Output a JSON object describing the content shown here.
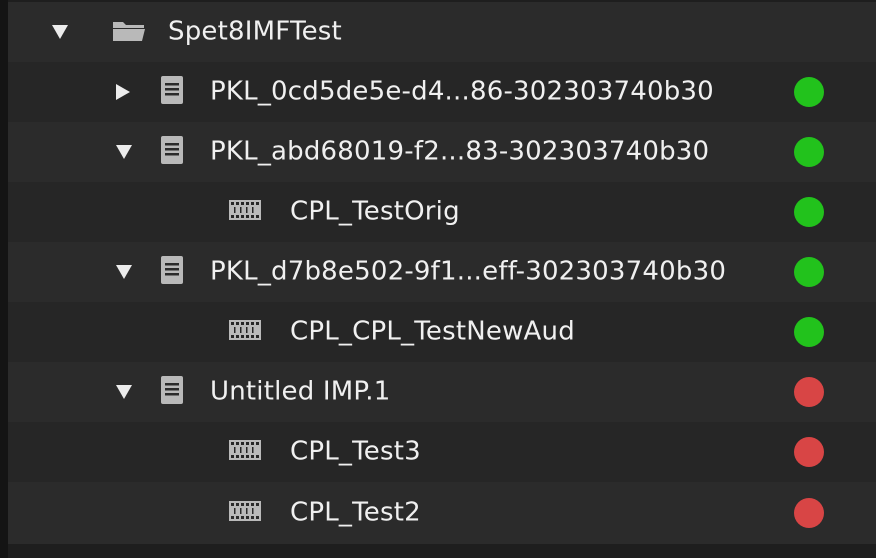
{
  "colors": {
    "ok": "#22c21c",
    "error": "#d84545",
    "text": "#f0f0f0",
    "icon": "#b9b9b9"
  },
  "tree": {
    "root": {
      "label": "Spet8IMFTest",
      "expanded": true,
      "icon": "folder-icon"
    },
    "items": [
      {
        "label": "PKL_0cd5de5e-d4...86-302303740b30",
        "type": "pkl",
        "expanded": false,
        "icon": "document-icon",
        "status": "ok"
      },
      {
        "label": "PKL_abd68019-f2...83-302303740b30",
        "type": "pkl",
        "expanded": true,
        "icon": "document-icon",
        "status": "ok"
      },
      {
        "label": "CPL_TestOrig",
        "type": "cpl",
        "icon": "film-icon",
        "status": "ok"
      },
      {
        "label": "PKL_d7b8e502-9f1...eff-302303740b30",
        "type": "pkl",
        "expanded": true,
        "icon": "document-icon",
        "status": "ok"
      },
      {
        "label": "CPL_CPL_TestNewAud",
        "type": "cpl",
        "icon": "film-icon",
        "status": "ok"
      },
      {
        "label": "Untitled IMP.1",
        "type": "pkl",
        "expanded": true,
        "icon": "document-icon",
        "status": "error"
      },
      {
        "label": "CPL_Test3",
        "type": "cpl",
        "icon": "film-icon",
        "status": "error"
      },
      {
        "label": "CPL_Test2",
        "type": "cpl",
        "icon": "film-icon",
        "status": "error"
      }
    ]
  }
}
